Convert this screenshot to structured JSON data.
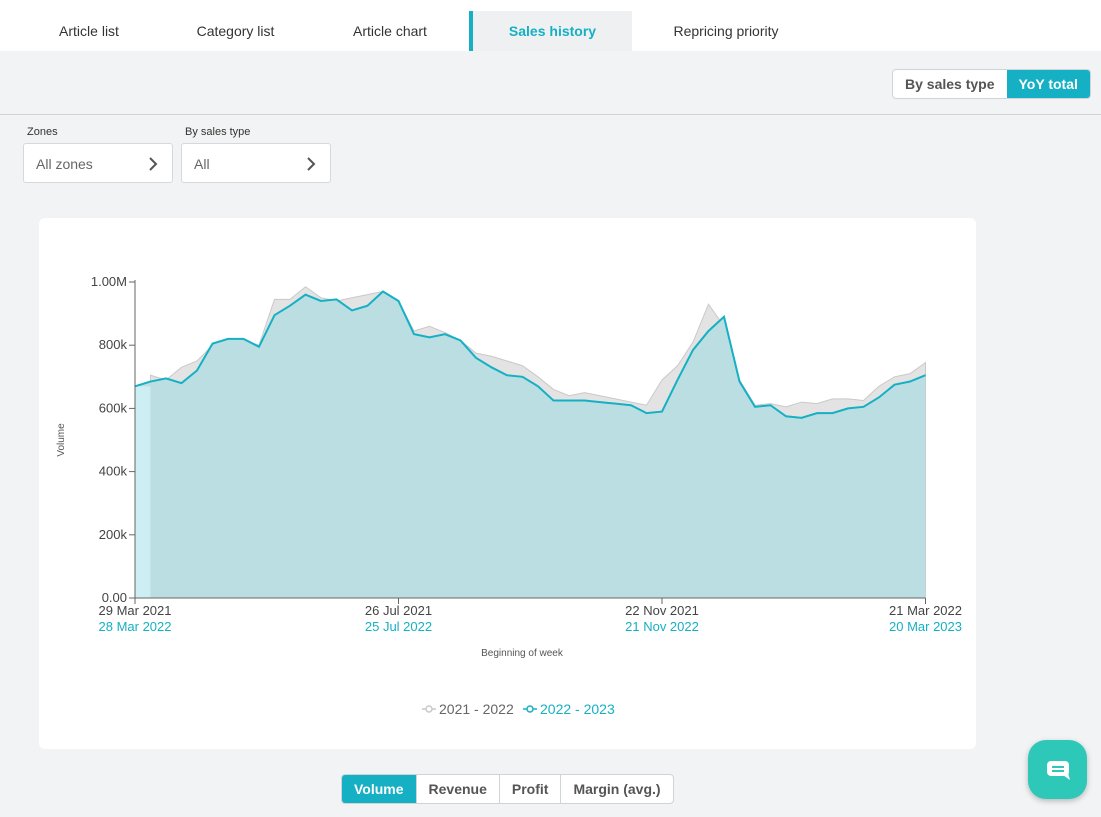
{
  "tabs": [
    {
      "label": "Article list"
    },
    {
      "label": "Category list"
    },
    {
      "label": "Article chart"
    },
    {
      "label": "Sales history",
      "active": true
    },
    {
      "label": "Repricing priority"
    }
  ],
  "view_toggle": {
    "by_sales_type": "By sales type",
    "yoy_total": "YoY total",
    "selected": "YoY total"
  },
  "filters": {
    "zones": {
      "label": "Zones",
      "value": "All zones"
    },
    "sales_type": {
      "label": "By sales type",
      "value": "All"
    }
  },
  "metric_toggle": {
    "options": [
      "Volume",
      "Revenue",
      "Profit",
      "Margin (avg.)"
    ],
    "selected": "Volume"
  },
  "colors": {
    "accent": "#15b0c4",
    "prev_year": "#c9c9c9",
    "area_current": "#b8dde2"
  },
  "icons": {
    "chat": "chat-icon",
    "chevron": "chevron-right-icon"
  },
  "chart_data": {
    "type": "area",
    "ylabel": "Volume",
    "xlabel": "Beginning of week",
    "ylim": [
      0,
      1000000
    ],
    "y_ticks": [
      "0.00",
      "200k",
      "400k",
      "600k",
      "800k",
      "1.00M"
    ],
    "x_ticks": [
      {
        "index": 0,
        "label_prev": "29 Mar 2021",
        "label_curr": "28 Mar 2022"
      },
      {
        "index": 17,
        "label_prev": "26 Jul 2021",
        "label_curr": "25 Jul 2022"
      },
      {
        "index": 34,
        "label_prev": "22 Nov 2021",
        "label_curr": "21 Nov 2022"
      },
      {
        "index": 51,
        "label_prev": "21 Mar 2022",
        "label_curr": "20 Mar 2023"
      }
    ],
    "legend": {
      "position": "bottom",
      "items": [
        "2021 - 2022",
        "2022 - 2023"
      ]
    },
    "series": [
      {
        "name": "2021 - 2022",
        "start_index": 1,
        "values": [
          705000,
          690000,
          730000,
          750000,
          800000,
          820000,
          815000,
          800000,
          945000,
          945000,
          985000,
          950000,
          940000,
          950000,
          960000,
          970000,
          940000,
          845000,
          860000,
          840000,
          815000,
          775000,
          765000,
          750000,
          735000,
          700000,
          660000,
          640000,
          650000,
          640000,
          630000,
          620000,
          610000,
          690000,
          735000,
          810000,
          930000,
          860000,
          690000,
          610000,
          615000,
          605000,
          620000,
          615000,
          630000,
          630000,
          625000,
          670000,
          700000,
          710000,
          745000
        ]
      },
      {
        "name": "2022 - 2023",
        "start_index": 0,
        "values": [
          670000,
          685000,
          695000,
          680000,
          720000,
          805000,
          820000,
          820000,
          795000,
          895000,
          925000,
          960000,
          940000,
          945000,
          910000,
          925000,
          970000,
          940000,
          835000,
          825000,
          835000,
          815000,
          760000,
          730000,
          705000,
          700000,
          670000,
          625000,
          625000,
          625000,
          620000,
          615000,
          610000,
          585000,
          590000,
          690000,
          785000,
          845000,
          890000,
          685000,
          605000,
          610000,
          575000,
          570000,
          585000,
          585000,
          600000,
          605000,
          635000,
          675000,
          685000,
          705000
        ]
      }
    ]
  }
}
